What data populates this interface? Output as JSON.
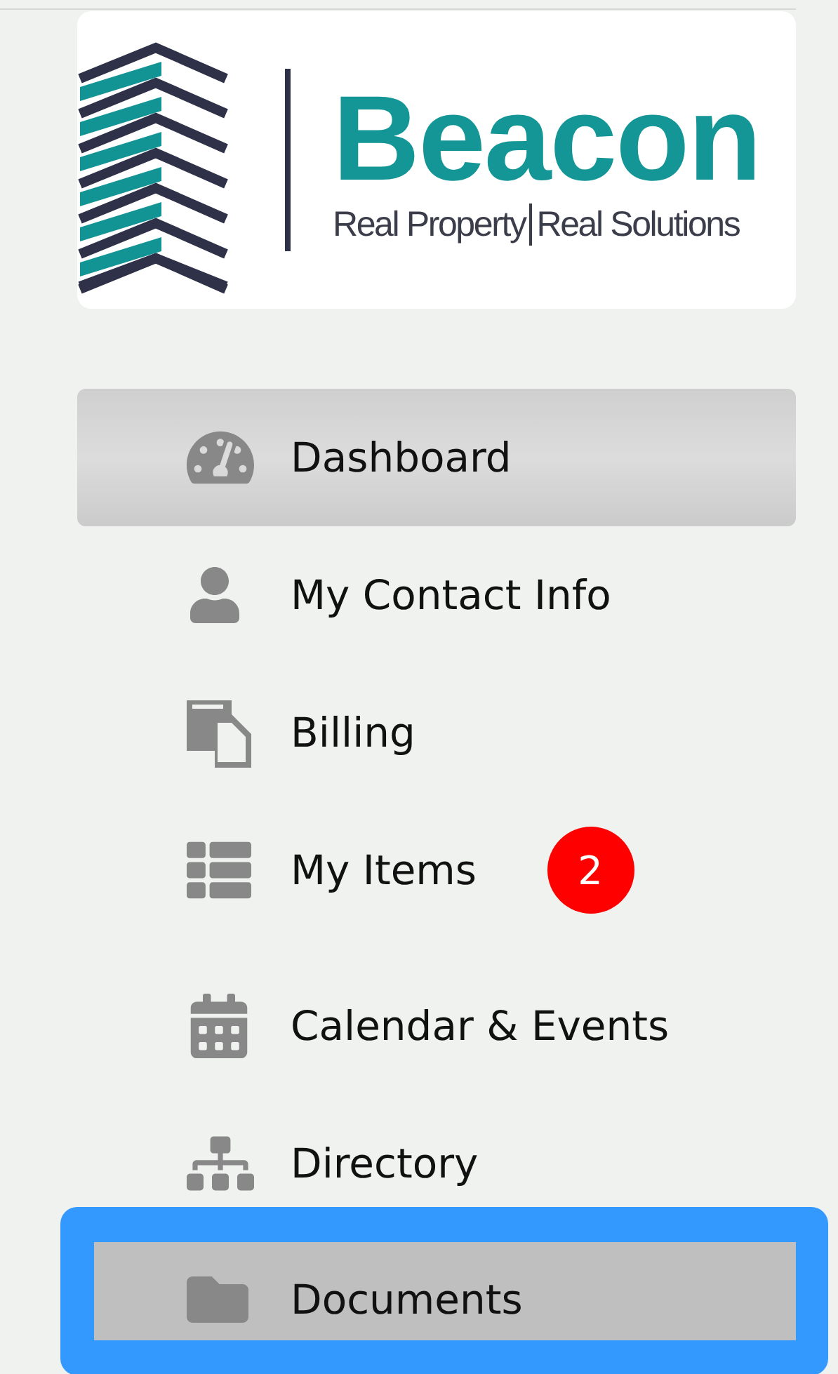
{
  "logo": {
    "brand": "Beacon",
    "tagline": [
      "Real Property",
      "Real Solutions"
    ]
  },
  "nav": [
    {
      "kind": "dashboard",
      "label": "Dashboard",
      "selected": true,
      "focused": false
    },
    {
      "kind": "contact",
      "label": "My Contact Info",
      "selected": false,
      "focused": false
    },
    {
      "kind": "billing",
      "label": "Billing",
      "selected": false,
      "focused": false
    },
    {
      "kind": "items",
      "label": "My Items",
      "selected": false,
      "focused": false,
      "badge": "2"
    },
    {
      "kind": "calendar",
      "label": "Calendar & Events",
      "selected": false,
      "focused": false
    },
    {
      "kind": "directory",
      "label": "Directory",
      "selected": false,
      "focused": false
    },
    {
      "kind": "documents",
      "label": "Documents",
      "selected": false,
      "focused": true
    }
  ]
}
